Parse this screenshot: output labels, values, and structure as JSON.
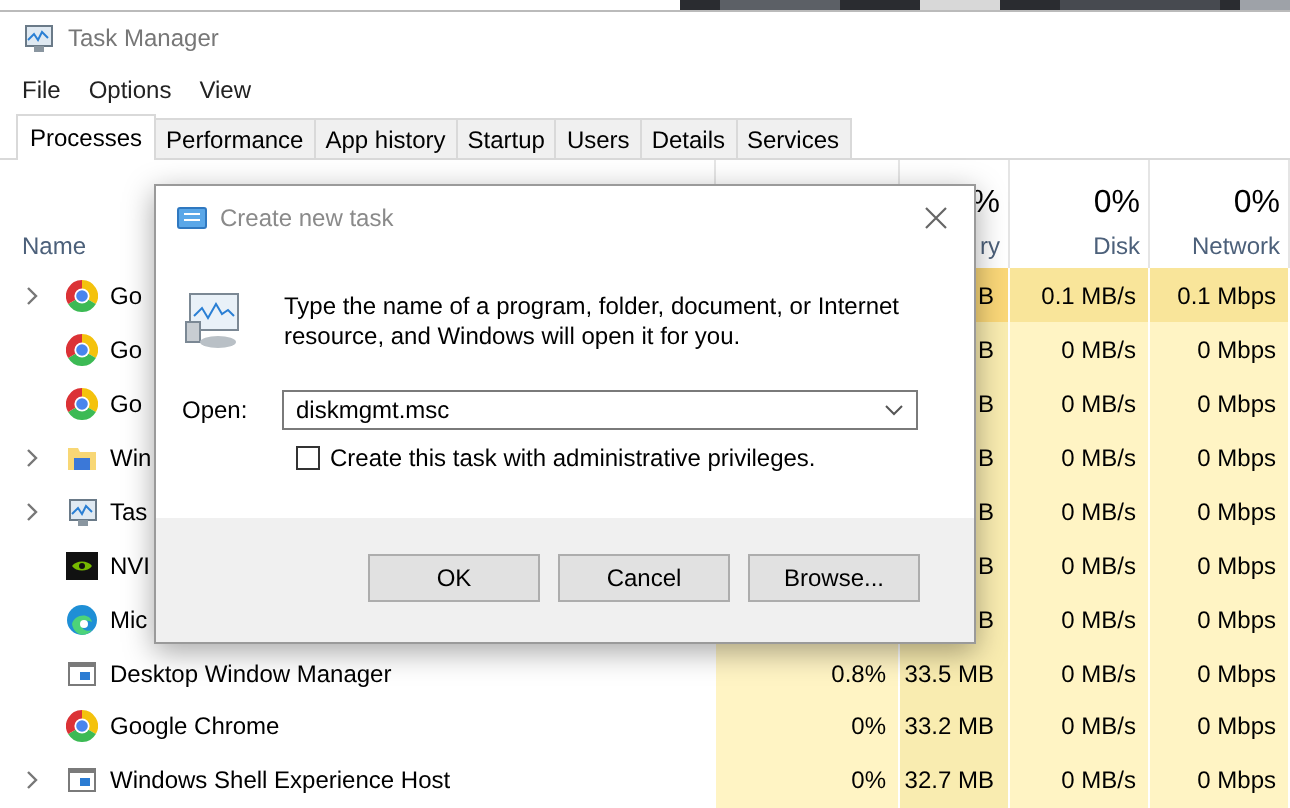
{
  "window": {
    "title": "Task Manager"
  },
  "menu": [
    "File",
    "Options",
    "View"
  ],
  "tabs": [
    {
      "label": "Processes",
      "selected": true
    },
    {
      "label": "Performance",
      "selected": false
    },
    {
      "label": "App history",
      "selected": false
    },
    {
      "label": "Startup",
      "selected": false
    },
    {
      "label": "Users",
      "selected": false
    },
    {
      "label": "Details",
      "selected": false
    },
    {
      "label": "Services",
      "selected": false
    }
  ],
  "columns": [
    {
      "label": "Name"
    },
    {
      "percent": "%",
      "label": "ry"
    },
    {
      "percent": "0%",
      "label": "Disk"
    },
    {
      "percent": "0%",
      "label": "Network"
    }
  ],
  "rows": [
    {
      "expandable": true,
      "kind": "chrome",
      "name": "Go",
      "memory": "B",
      "disk": "0.1 MB/s",
      "network": "0.1 Mbps",
      "active": true
    },
    {
      "expandable": false,
      "kind": "chrome",
      "name": "Go",
      "memory": "B",
      "disk": "0 MB/s",
      "network": "0 Mbps",
      "active": false
    },
    {
      "expandable": false,
      "kind": "chrome",
      "name": "Go",
      "memory": "B",
      "disk": "0 MB/s",
      "network": "0 Mbps",
      "active": false
    },
    {
      "expandable": true,
      "kind": "folder",
      "name": "Win",
      "memory": "B",
      "disk": "0 MB/s",
      "network": "0 Mbps",
      "active": false
    },
    {
      "expandable": true,
      "kind": "monitor",
      "name": "Tas",
      "memory": "B",
      "disk": "0 MB/s",
      "network": "0 Mbps",
      "active": false
    },
    {
      "expandable": false,
      "kind": "gpu",
      "name": "NVI",
      "memory": "B",
      "disk": "0 MB/s",
      "network": "0 Mbps",
      "active": false
    },
    {
      "expandable": false,
      "kind": "edge",
      "name": "Mic",
      "memory": "B",
      "disk": "0 MB/s",
      "network": "0 Mbps",
      "active": false
    },
    {
      "expandable": false,
      "kind": "window",
      "name": "Desktop Window Manager",
      "cpu": "0.8%",
      "memory": "33.5 MB",
      "disk": "0 MB/s",
      "network": "0 Mbps",
      "active": false
    },
    {
      "expandable": false,
      "kind": "chrome",
      "name": "Google Chrome",
      "cpu": "0%",
      "memory": "33.2 MB",
      "disk": "0 MB/s",
      "network": "0 Mbps",
      "active": false
    },
    {
      "expandable": true,
      "kind": "window",
      "name": "Windows Shell Experience Host",
      "cpu": "0%",
      "memory": "32.7 MB",
      "disk": "0 MB/s",
      "network": "0 Mbps",
      "active": false
    }
  ],
  "dialog": {
    "title": "Create new task",
    "message": "Type the name of a program, folder, document, or Internet resource, and Windows will open it for you.",
    "open_label": "Open:",
    "command": {
      "value": "diskmgmt.msc"
    },
    "admin_option": {
      "label": "Create this task with administrative privileges.",
      "checked": false
    },
    "buttons": [
      "OK",
      "Cancel",
      "Browse..."
    ]
  }
}
